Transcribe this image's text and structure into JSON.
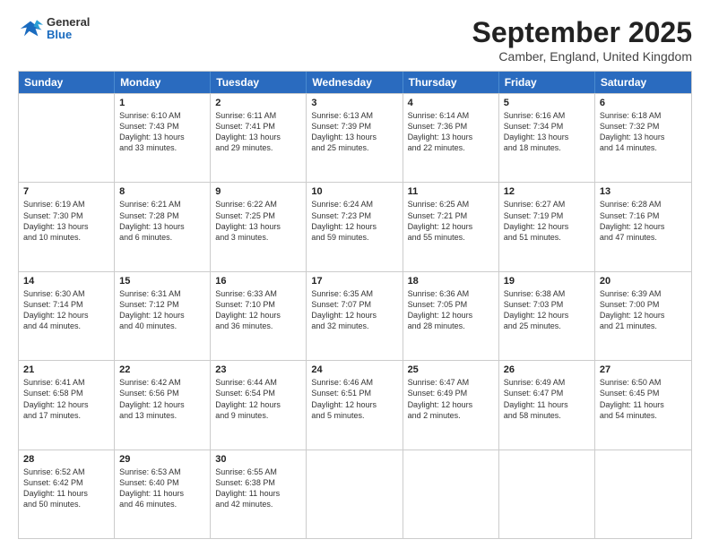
{
  "header": {
    "logo": {
      "general": "General",
      "blue": "Blue"
    },
    "title": "September 2025",
    "location": "Camber, England, United Kingdom"
  },
  "weekdays": [
    "Sunday",
    "Monday",
    "Tuesday",
    "Wednesday",
    "Thursday",
    "Friday",
    "Saturday"
  ],
  "weeks": [
    [
      {
        "day": "",
        "lines": []
      },
      {
        "day": "1",
        "lines": [
          "Sunrise: 6:10 AM",
          "Sunset: 7:43 PM",
          "Daylight: 13 hours",
          "and 33 minutes."
        ]
      },
      {
        "day": "2",
        "lines": [
          "Sunrise: 6:11 AM",
          "Sunset: 7:41 PM",
          "Daylight: 13 hours",
          "and 29 minutes."
        ]
      },
      {
        "day": "3",
        "lines": [
          "Sunrise: 6:13 AM",
          "Sunset: 7:39 PM",
          "Daylight: 13 hours",
          "and 25 minutes."
        ]
      },
      {
        "day": "4",
        "lines": [
          "Sunrise: 6:14 AM",
          "Sunset: 7:36 PM",
          "Daylight: 13 hours",
          "and 22 minutes."
        ]
      },
      {
        "day": "5",
        "lines": [
          "Sunrise: 6:16 AM",
          "Sunset: 7:34 PM",
          "Daylight: 13 hours",
          "and 18 minutes."
        ]
      },
      {
        "day": "6",
        "lines": [
          "Sunrise: 6:18 AM",
          "Sunset: 7:32 PM",
          "Daylight: 13 hours",
          "and 14 minutes."
        ]
      }
    ],
    [
      {
        "day": "7",
        "lines": [
          "Sunrise: 6:19 AM",
          "Sunset: 7:30 PM",
          "Daylight: 13 hours",
          "and 10 minutes."
        ]
      },
      {
        "day": "8",
        "lines": [
          "Sunrise: 6:21 AM",
          "Sunset: 7:28 PM",
          "Daylight: 13 hours",
          "and 6 minutes."
        ]
      },
      {
        "day": "9",
        "lines": [
          "Sunrise: 6:22 AM",
          "Sunset: 7:25 PM",
          "Daylight: 13 hours",
          "and 3 minutes."
        ]
      },
      {
        "day": "10",
        "lines": [
          "Sunrise: 6:24 AM",
          "Sunset: 7:23 PM",
          "Daylight: 12 hours",
          "and 59 minutes."
        ]
      },
      {
        "day": "11",
        "lines": [
          "Sunrise: 6:25 AM",
          "Sunset: 7:21 PM",
          "Daylight: 12 hours",
          "and 55 minutes."
        ]
      },
      {
        "day": "12",
        "lines": [
          "Sunrise: 6:27 AM",
          "Sunset: 7:19 PM",
          "Daylight: 12 hours",
          "and 51 minutes."
        ]
      },
      {
        "day": "13",
        "lines": [
          "Sunrise: 6:28 AM",
          "Sunset: 7:16 PM",
          "Daylight: 12 hours",
          "and 47 minutes."
        ]
      }
    ],
    [
      {
        "day": "14",
        "lines": [
          "Sunrise: 6:30 AM",
          "Sunset: 7:14 PM",
          "Daylight: 12 hours",
          "and 44 minutes."
        ]
      },
      {
        "day": "15",
        "lines": [
          "Sunrise: 6:31 AM",
          "Sunset: 7:12 PM",
          "Daylight: 12 hours",
          "and 40 minutes."
        ]
      },
      {
        "day": "16",
        "lines": [
          "Sunrise: 6:33 AM",
          "Sunset: 7:10 PM",
          "Daylight: 12 hours",
          "and 36 minutes."
        ]
      },
      {
        "day": "17",
        "lines": [
          "Sunrise: 6:35 AM",
          "Sunset: 7:07 PM",
          "Daylight: 12 hours",
          "and 32 minutes."
        ]
      },
      {
        "day": "18",
        "lines": [
          "Sunrise: 6:36 AM",
          "Sunset: 7:05 PM",
          "Daylight: 12 hours",
          "and 28 minutes."
        ]
      },
      {
        "day": "19",
        "lines": [
          "Sunrise: 6:38 AM",
          "Sunset: 7:03 PM",
          "Daylight: 12 hours",
          "and 25 minutes."
        ]
      },
      {
        "day": "20",
        "lines": [
          "Sunrise: 6:39 AM",
          "Sunset: 7:00 PM",
          "Daylight: 12 hours",
          "and 21 minutes."
        ]
      }
    ],
    [
      {
        "day": "21",
        "lines": [
          "Sunrise: 6:41 AM",
          "Sunset: 6:58 PM",
          "Daylight: 12 hours",
          "and 17 minutes."
        ]
      },
      {
        "day": "22",
        "lines": [
          "Sunrise: 6:42 AM",
          "Sunset: 6:56 PM",
          "Daylight: 12 hours",
          "and 13 minutes."
        ]
      },
      {
        "day": "23",
        "lines": [
          "Sunrise: 6:44 AM",
          "Sunset: 6:54 PM",
          "Daylight: 12 hours",
          "and 9 minutes."
        ]
      },
      {
        "day": "24",
        "lines": [
          "Sunrise: 6:46 AM",
          "Sunset: 6:51 PM",
          "Daylight: 12 hours",
          "and 5 minutes."
        ]
      },
      {
        "day": "25",
        "lines": [
          "Sunrise: 6:47 AM",
          "Sunset: 6:49 PM",
          "Daylight: 12 hours",
          "and 2 minutes."
        ]
      },
      {
        "day": "26",
        "lines": [
          "Sunrise: 6:49 AM",
          "Sunset: 6:47 PM",
          "Daylight: 11 hours",
          "and 58 minutes."
        ]
      },
      {
        "day": "27",
        "lines": [
          "Sunrise: 6:50 AM",
          "Sunset: 6:45 PM",
          "Daylight: 11 hours",
          "and 54 minutes."
        ]
      }
    ],
    [
      {
        "day": "28",
        "lines": [
          "Sunrise: 6:52 AM",
          "Sunset: 6:42 PM",
          "Daylight: 11 hours",
          "and 50 minutes."
        ]
      },
      {
        "day": "29",
        "lines": [
          "Sunrise: 6:53 AM",
          "Sunset: 6:40 PM",
          "Daylight: 11 hours",
          "and 46 minutes."
        ]
      },
      {
        "day": "30",
        "lines": [
          "Sunrise: 6:55 AM",
          "Sunset: 6:38 PM",
          "Daylight: 11 hours",
          "and 42 minutes."
        ]
      },
      {
        "day": "",
        "lines": []
      },
      {
        "day": "",
        "lines": []
      },
      {
        "day": "",
        "lines": []
      },
      {
        "day": "",
        "lines": []
      }
    ]
  ]
}
